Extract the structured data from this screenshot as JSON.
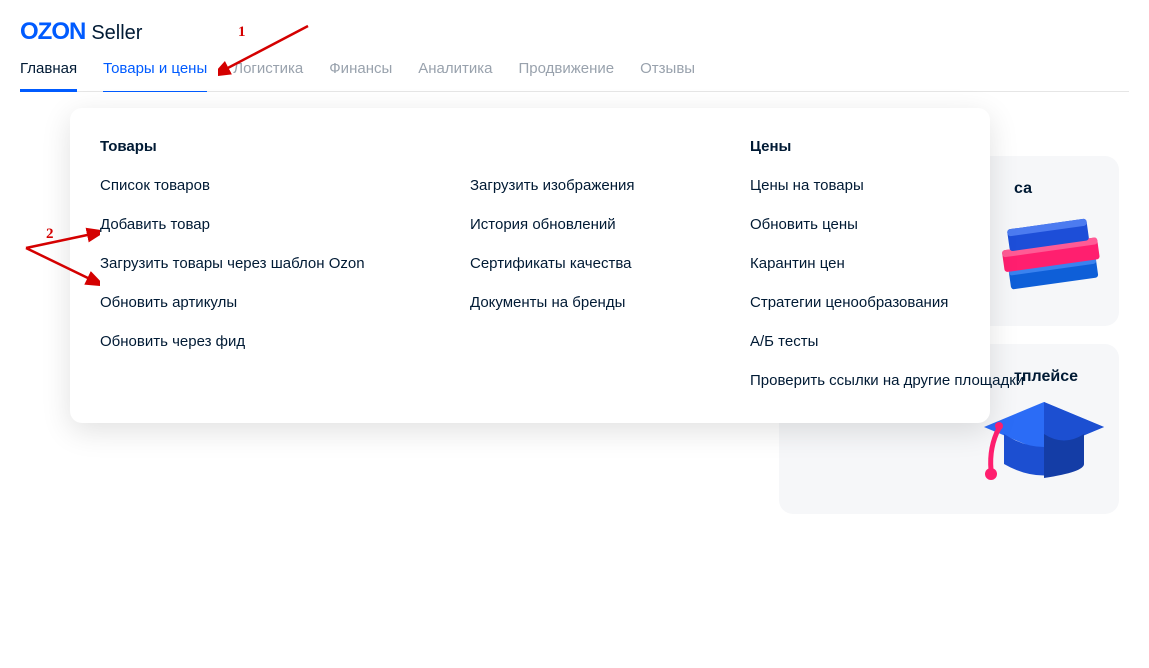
{
  "brand": {
    "ozon": "OZON",
    "seller": "Seller"
  },
  "nav": {
    "items": [
      {
        "label": "Главная"
      },
      {
        "label": "Товары и цены"
      },
      {
        "label": "Логистика"
      },
      {
        "label": "Финансы"
      },
      {
        "label": "Аналитика"
      },
      {
        "label": "Продвижение"
      },
      {
        "label": "Отзывы"
      }
    ]
  },
  "dropdown": {
    "col1": {
      "title": "Товары",
      "items": [
        "Список товаров",
        "Добавить товар",
        "Загрузить товары через шаблон Ozon",
        "Обновить артикулы",
        "Обновить через фид"
      ]
    },
    "col2": {
      "items": [
        "Загрузить изображения",
        "История обновлений",
        "Сертификаты качества",
        "Документы на бренды"
      ]
    },
    "col3": {
      "title": "Цены",
      "items": [
        "Цены на товары",
        "Обновить цены",
        "Карантин цен",
        "Стратегии ценообразования",
        "А/Б тесты",
        "Проверить ссылки на другие площадки"
      ]
    }
  },
  "bg_cards": {
    "card1_peek": "са",
    "card2_peek": "тплейсе"
  },
  "annotations": {
    "num1": "1",
    "num2": "2"
  }
}
